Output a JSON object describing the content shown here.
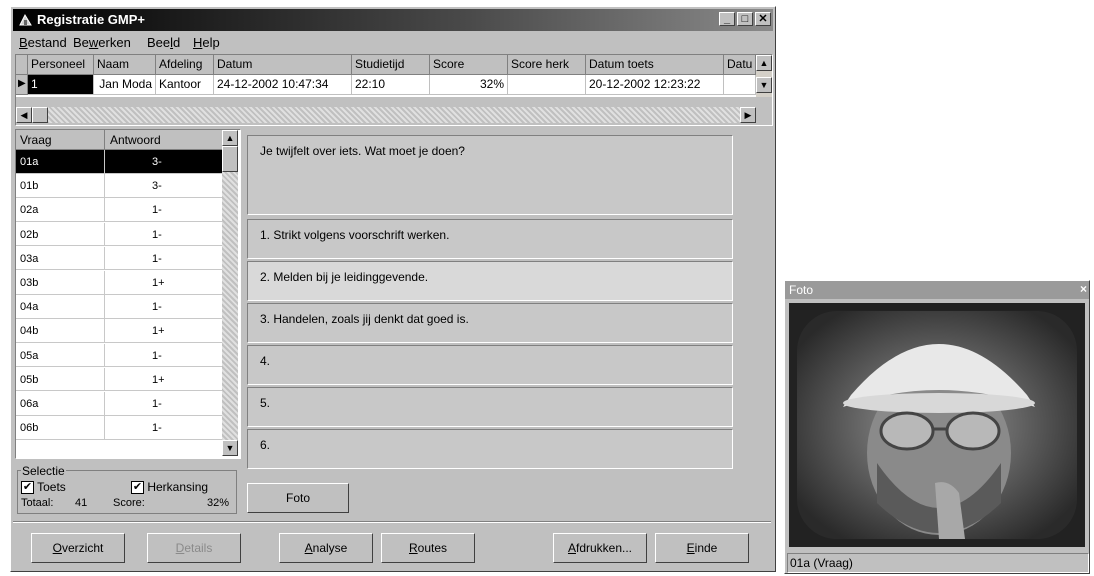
{
  "app": {
    "title": "Registratie GMP+"
  },
  "titlebar_buttons": {
    "minimize": "_",
    "maximize": "□",
    "close": "✕"
  },
  "menu": [
    "Bestand",
    "Bewerken",
    "Beeld",
    "Help"
  ],
  "top_grid": {
    "headers": [
      "Personeel",
      "Naam",
      "Afdeling",
      "Datum",
      "Studietijd",
      "Score",
      "Score herk",
      "Datum toets",
      "Datu"
    ],
    "row": [
      "1",
      "Jan Moda",
      "Kantoor",
      "24-12-2002 10:47:34",
      "22:10",
      "32%",
      "",
      "20-12-2002 12:23:22",
      ""
    ]
  },
  "list": {
    "headers": [
      "Vraag",
      "Antwoord"
    ],
    "rows": [
      [
        "01a",
        "3-"
      ],
      [
        "01b",
        "3-"
      ],
      [
        "02a",
        "1-"
      ],
      [
        "02b",
        "1-"
      ],
      [
        "03a",
        "1-"
      ],
      [
        "03b",
        "1+"
      ],
      [
        "04a",
        "1-"
      ],
      [
        "04b",
        "1+"
      ],
      [
        "05a",
        "1-"
      ],
      [
        "05b",
        "1+"
      ],
      [
        "06a",
        "1-"
      ],
      [
        "06b",
        "1-"
      ]
    ],
    "selected_index": 0
  },
  "selectie": {
    "label": "Selectie",
    "toets": "Toets",
    "toets_checked": true,
    "herkansing": "Herkansing",
    "herkansing_checked": true,
    "totaal_label": "Totaal:",
    "totaal_value": "41",
    "score_label": "Score:",
    "score_value": "32%"
  },
  "question": {
    "text": "Je twijfelt over iets.   Wat moet je doen?",
    "answers": [
      "1.  Strikt volgens voorschrift werken.",
      "2.  Melden bij je leidinggevende.",
      "3.  Handelen, zoals jij denkt dat goed is.",
      "4.",
      "5.",
      "6."
    ],
    "highlighted_answer": 1
  },
  "buttons": {
    "foto": "Foto",
    "overzicht": "Overzicht",
    "details": "Details",
    "analyse": "Analyse",
    "routes": "Routes",
    "afdrukken": "Afdrukken...",
    "einde": "Einde"
  },
  "foto_window": {
    "title": "Foto",
    "caption": "01a (Vraag)"
  }
}
